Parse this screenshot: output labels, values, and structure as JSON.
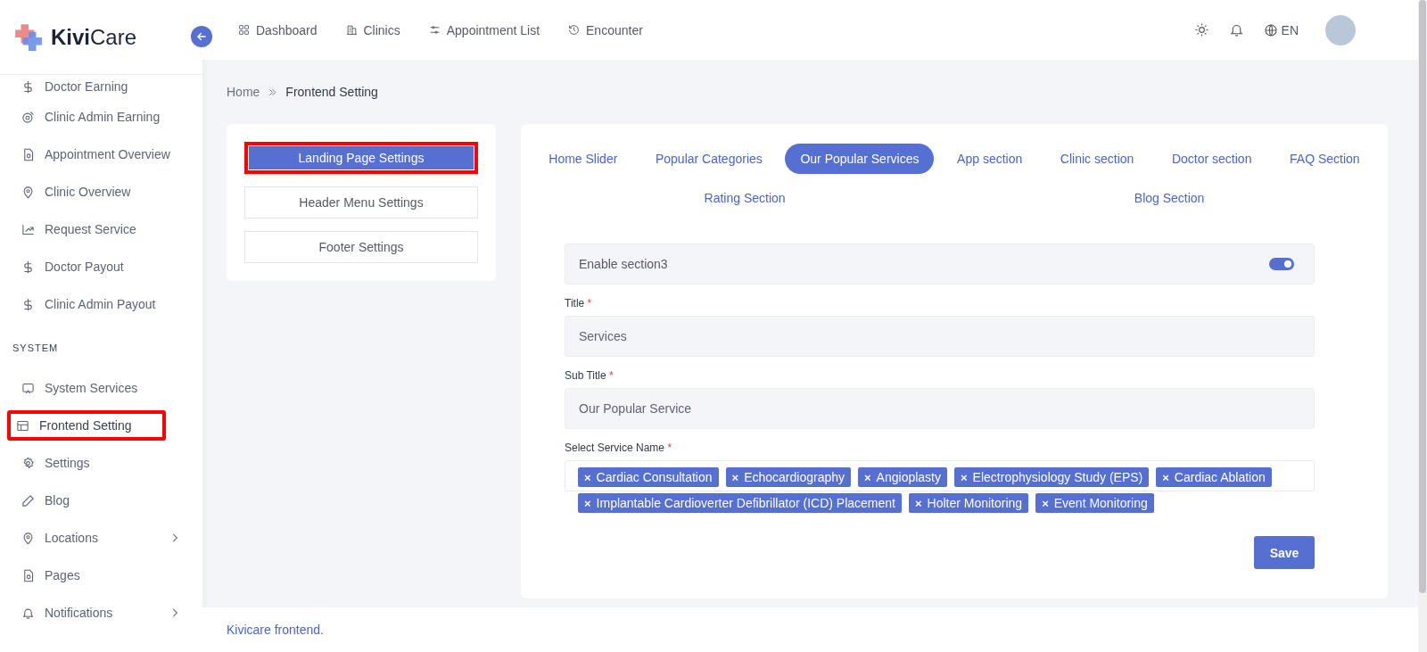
{
  "brand": {
    "name_bold": "Kivi",
    "name_rest": "Care"
  },
  "top_nav": [
    {
      "label": "Dashboard"
    },
    {
      "label": "Clinics"
    },
    {
      "label": "Appointment List"
    },
    {
      "label": "Encounter"
    }
  ],
  "header_right": {
    "language": "EN"
  },
  "sidebar": {
    "items": [
      {
        "label": "Doctor Earning",
        "selected": false,
        "has_children": false,
        "highlighted": false
      },
      {
        "label": "Clinic Admin Earning",
        "selected": false,
        "has_children": false,
        "highlighted": false
      },
      {
        "label": "Appointment Overview",
        "selected": false,
        "has_children": false,
        "highlighted": false
      },
      {
        "label": "Clinic Overview",
        "selected": false,
        "has_children": false,
        "highlighted": false
      },
      {
        "label": "Request Service",
        "selected": false,
        "has_children": false,
        "highlighted": false
      },
      {
        "label": "Doctor Payout",
        "selected": false,
        "has_children": false,
        "highlighted": false
      },
      {
        "label": "Clinic Admin Payout",
        "selected": false,
        "has_children": false,
        "highlighted": false
      },
      {
        "kind": "heading",
        "label": "SYSTEM"
      },
      {
        "label": "System Services",
        "selected": false,
        "has_children": false,
        "highlighted": false
      },
      {
        "label": "Frontend Setting",
        "selected": true,
        "has_children": false,
        "highlighted": true
      },
      {
        "label": "Settings",
        "selected": false,
        "has_children": false,
        "highlighted": false
      },
      {
        "label": "Blog",
        "selected": false,
        "has_children": false,
        "highlighted": false
      },
      {
        "label": "Locations",
        "selected": false,
        "has_children": true,
        "highlighted": false
      },
      {
        "label": "Pages",
        "selected": false,
        "has_children": false,
        "highlighted": false
      },
      {
        "label": "Notifications",
        "selected": false,
        "has_children": true,
        "highlighted": false
      }
    ]
  },
  "breadcrumb": {
    "items": [
      "Home",
      "Frontend Setting"
    ]
  },
  "settings_menu": [
    {
      "label": "Landing Page Settings",
      "selected": true,
      "highlighted": true
    },
    {
      "label": "Header Menu Settings",
      "selected": false,
      "highlighted": false
    },
    {
      "label": "Footer Settings",
      "selected": false,
      "highlighted": false
    }
  ],
  "section_tabs": [
    {
      "label": "Home Slider",
      "selected": false
    },
    {
      "label": "Popular Categories",
      "selected": false
    },
    {
      "label": "Our Popular Services",
      "selected": true
    },
    {
      "label": "App section",
      "selected": false
    },
    {
      "label": "Clinic section",
      "selected": false
    },
    {
      "label": "Doctor section",
      "selected": false
    },
    {
      "label": "FAQ Section",
      "selected": false
    },
    {
      "label": "Rating Section",
      "selected": false
    },
    {
      "label": "Blog Section",
      "selected": false
    }
  ],
  "form": {
    "enable": {
      "label": "Enable section3",
      "on": true
    },
    "title": {
      "label": "Title",
      "required_mark": "*",
      "value": "Services"
    },
    "sub_title": {
      "label": "Sub Title",
      "required_mark": "*",
      "value": "Our Popular Service"
    },
    "services": {
      "label": "Select Service Name",
      "required_mark": "*",
      "remove_mark": "×",
      "tags": [
        "Cardiac Consultation",
        "Echocardiography",
        "Angioplasty",
        "Electrophysiology Study (EPS)",
        "Cardiac Ablation",
        "Implantable Cardioverter Defibrillator (ICD) Placement",
        "Holter Monitoring",
        "Event Monitoring"
      ]
    },
    "save": "Save"
  },
  "footer": {
    "text": "Kivicare frontend."
  }
}
